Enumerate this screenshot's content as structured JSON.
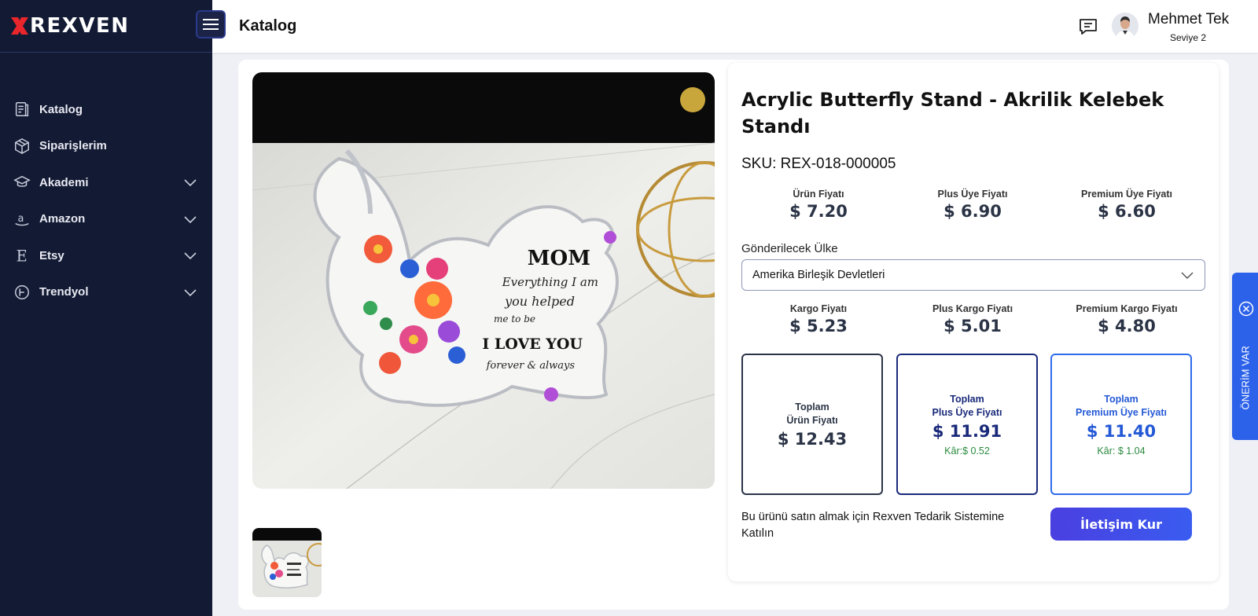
{
  "brand": {
    "name": "REXVEN"
  },
  "sidebar": {
    "items": [
      {
        "label": "Katalog",
        "icon": "catalog-icon",
        "expandable": false
      },
      {
        "label": "Siparişlerim",
        "icon": "box-icon",
        "expandable": false
      },
      {
        "label": "Akademi",
        "icon": "graduation-cap-icon",
        "expandable": true
      },
      {
        "label": "Amazon",
        "icon": "amazon-icon",
        "expandable": true
      },
      {
        "label": "Etsy",
        "icon": "etsy-icon",
        "expandable": true
      },
      {
        "label": "Trendyol",
        "icon": "trendyol-icon",
        "expandable": true
      }
    ]
  },
  "header": {
    "title": "Katalog",
    "user": {
      "name": "Mehmet Tek",
      "level": "Seviye 2"
    }
  },
  "product": {
    "title": "Acrylic Butterfly Stand - Akrilik Kelebek Standı",
    "sku": "SKU: REX-018-000005",
    "image_text": {
      "line1": "MOM",
      "line2": "Everything I am",
      "line3": "you helped",
      "line4": "me to be",
      "line5": "I LOVE YOU",
      "line6": "forever & always"
    }
  },
  "prices": [
    {
      "label": "Ürün Fiyatı",
      "value": "$ 7.20"
    },
    {
      "label": "Plus Üye Fiyatı",
      "value": "$ 6.90"
    },
    {
      "label": "Premium Üye Fiyatı",
      "value": "$ 6.60"
    }
  ],
  "country": {
    "label": "Gönderilecek Ülke",
    "selected": "Amerika Birleşik Devletleri"
  },
  "shipping": [
    {
      "label": "Kargo Fiyatı",
      "value": "$ 5.23"
    },
    {
      "label": "Plus Kargo Fiyatı",
      "value": "$ 5.01"
    },
    {
      "label": "Premium Kargo Fiyatı",
      "value": "$ 4.80"
    }
  ],
  "totals": [
    {
      "label1": "Toplam",
      "label2": "Ürün Fiyatı",
      "value": "$ 12.43",
      "profit": ""
    },
    {
      "label1": "Toplam",
      "label2": "Plus Üye Fiyatı",
      "value": "$ 11.91",
      "profit": "Kâr:$ 0.52"
    },
    {
      "label1": "Toplam",
      "label2": "Premium Üye Fiyatı",
      "value": "$ 11.40",
      "profit": "Kâr: $ 1.04"
    }
  ],
  "cta": {
    "text": "Bu ürünü satın almak için Rexven Tedarik Sistemine Katılın",
    "button": "İletişim Kur"
  },
  "side_tab": {
    "label": "ÖNERİM VAR"
  },
  "colors": {
    "sidebar_bg": "#131a33",
    "accent": "#2c61ea",
    "button": "#4a3fe0",
    "profit": "#2a8a3e"
  }
}
